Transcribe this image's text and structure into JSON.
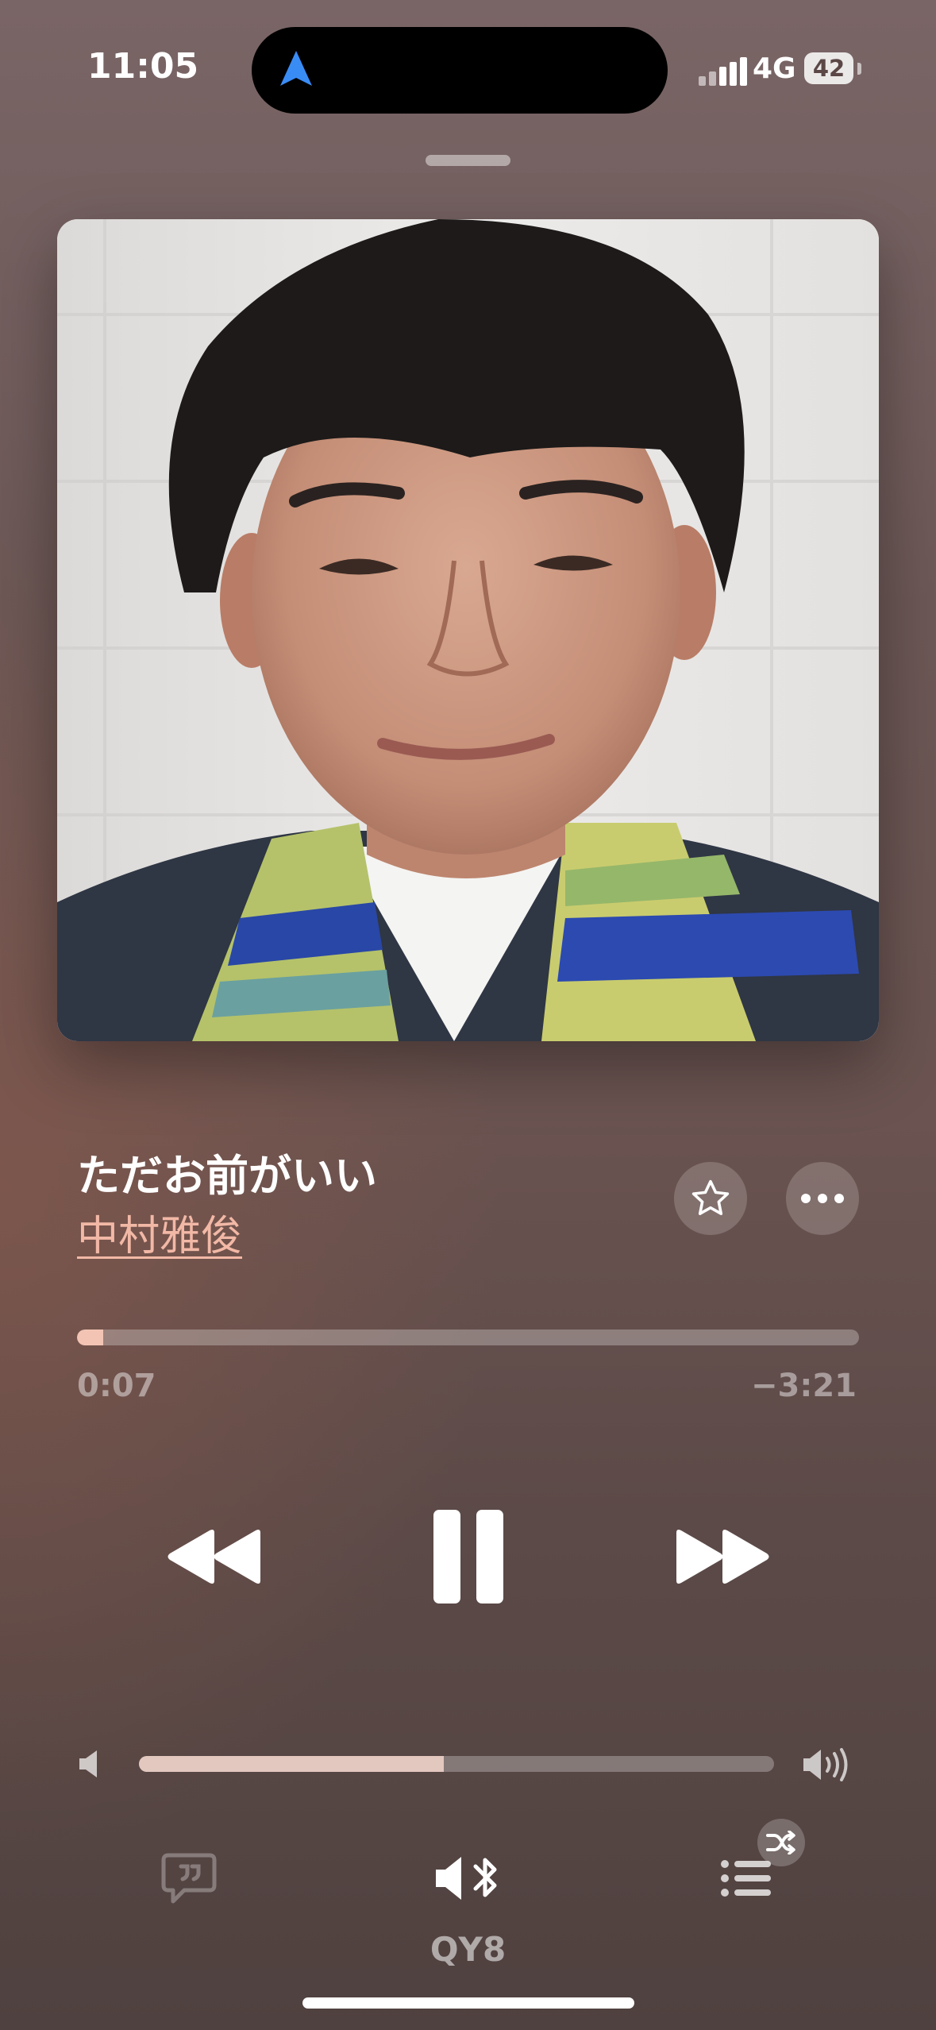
{
  "status_bar": {
    "time": "11:05",
    "network": "4G",
    "battery": "42",
    "location_icon": "location-arrow-icon",
    "location_color": "#3a8cf5"
  },
  "now_playing": {
    "title": "ただお前がいい",
    "artist": "中村雅俊",
    "artwork_icon": "album-artwork-portrait"
  },
  "playback": {
    "elapsed": "0:07",
    "remaining": "−3:21",
    "progress": 0.034,
    "state": "playing"
  },
  "volume": {
    "level": 0.48
  },
  "controls": {
    "favorite_icon": "star-icon",
    "more_icon": "ellipsis-icon",
    "rewind_icon": "rewind-icon",
    "pause_icon": "pause-icon",
    "forward_icon": "fast-forward-icon",
    "lyrics_icon": "lyrics-quote-bubble-icon",
    "output_icon": "speaker-bluetooth-icon",
    "queue_icon": "queue-list-icon",
    "shuffle_icon": "shuffle-icon"
  },
  "output_device": "QY8",
  "colors": {
    "accent": "#f2b8a6",
    "progress_fill": "#f3c4b4"
  }
}
